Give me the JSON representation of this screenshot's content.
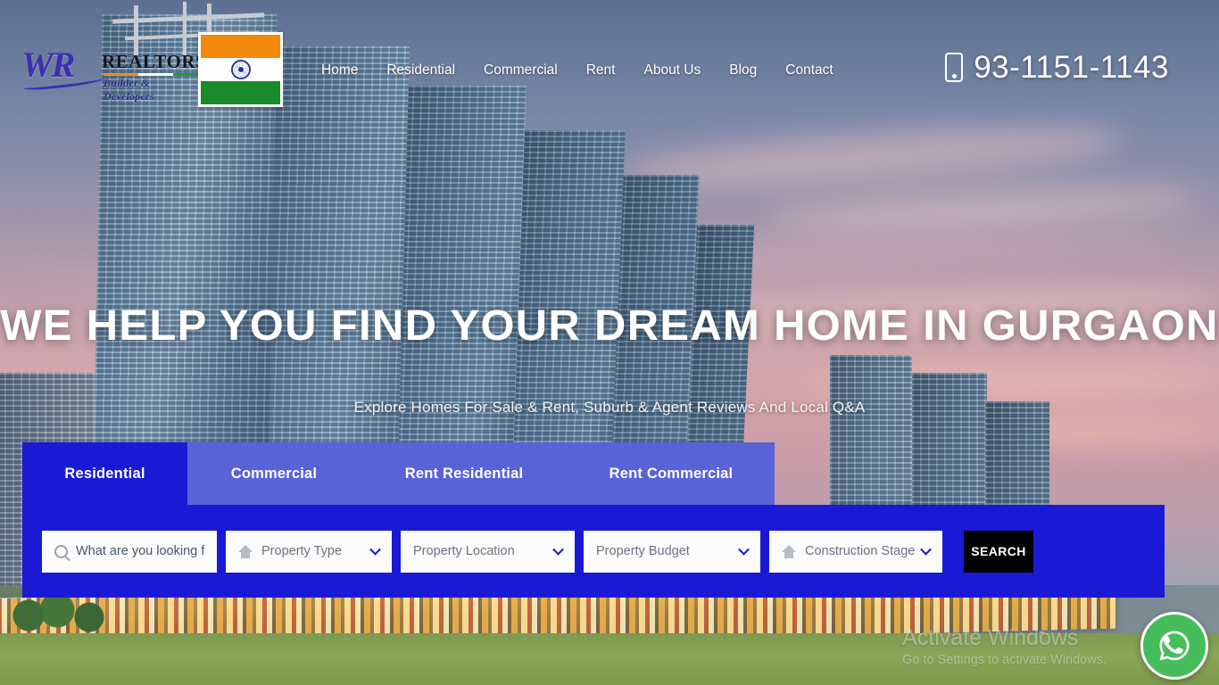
{
  "header": {
    "logo": {
      "mark": "WR",
      "name": "REALTORS",
      "tagline": "Builder & Developers",
      "flag_alt": "india-flag"
    },
    "nav": [
      {
        "label": "Home"
      },
      {
        "label": "Residential"
      },
      {
        "label": "Commercial"
      },
      {
        "label": "Rent"
      },
      {
        "label": "About Us"
      },
      {
        "label": "Blog"
      },
      {
        "label": "Contact"
      }
    ],
    "phone": "93-1151-1143"
  },
  "hero": {
    "title": "WE HELP YOU FIND YOUR DREAM HOME IN GURGAON",
    "subtitle": "Explore Homes For Sale & Rent, Suburb & Agent Reviews And Local Q&A"
  },
  "search": {
    "tabs": [
      {
        "label": "Residential",
        "active": true
      },
      {
        "label": "Commercial",
        "active": false
      },
      {
        "label": "Rent Residential",
        "active": false
      },
      {
        "label": "Rent Commercial",
        "active": false
      }
    ],
    "keyword_placeholder": "What are you looking for",
    "keyword_value": "",
    "property_type": "Property Type",
    "property_location": "Property Location",
    "property_budget": "Property Budget",
    "construction_stage": "Construction Stage",
    "submit_label": "SEARCH"
  },
  "watermark": {
    "line1": "Activate Windows",
    "line2": "Go to Settings to activate Windows."
  },
  "colors": {
    "panel_blue": "#1a1ad5",
    "tab_inactive": "#5a62d8",
    "search_button": "#000000",
    "whatsapp_green": "#46bd5a",
    "logo_purple": "#3b2fb0"
  }
}
